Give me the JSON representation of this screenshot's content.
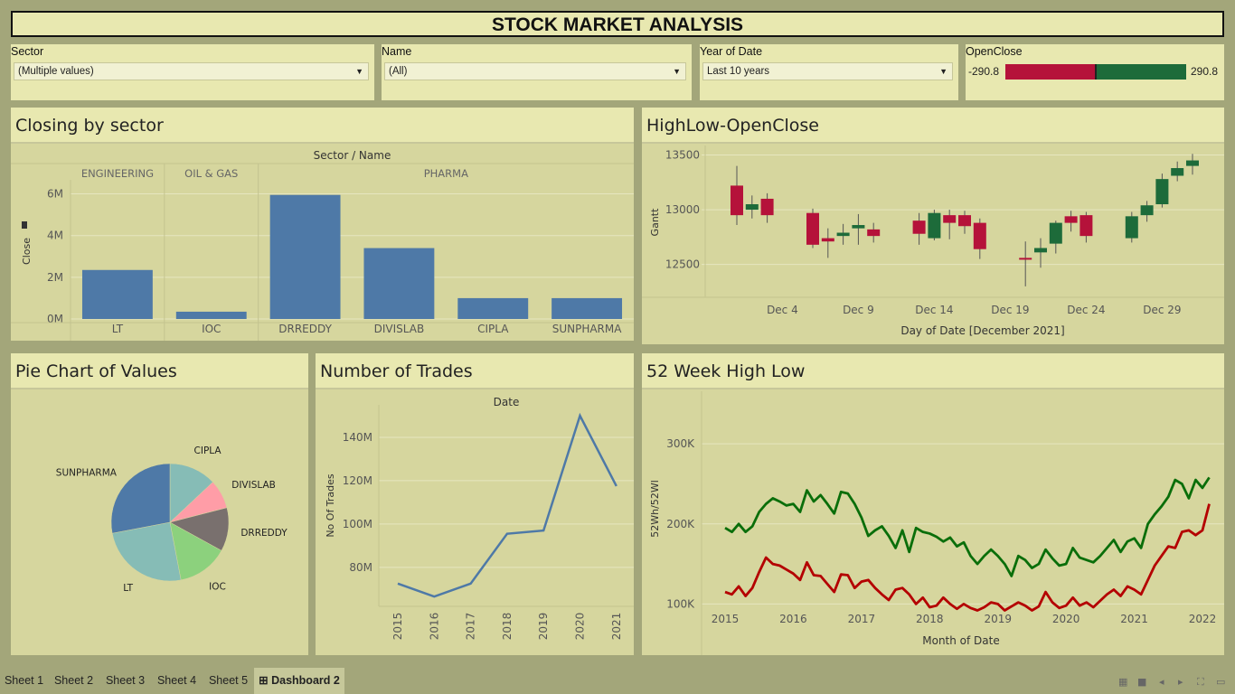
{
  "title": "STOCK MARKET ANALYSIS",
  "filters": {
    "sector": {
      "label": "Sector",
      "value": "(Multiple values)"
    },
    "name": {
      "label": "Name",
      "value": "(All)"
    },
    "year": {
      "label": "Year of Date",
      "value": "Last 10 years"
    },
    "openclose": {
      "label": "OpenClose",
      "min": "-290.8",
      "max": "290.8",
      "neg_color": "#b5123a",
      "pos_color": "#1d6b3a"
    }
  },
  "panels": {
    "closing": "Closing by sector",
    "hilo": "HighLow-OpenClose",
    "pie": "Pie Chart of Values",
    "trades": "Number of Trades",
    "wk52": "52 Week High Low"
  },
  "colors": {
    "bar": "#4e79a7",
    "up": "#1d6b3a",
    "down": "#b5123a",
    "line": "#4e79a7",
    "high": "#0a6e0a",
    "low": "#b40000"
  },
  "chart_data": [
    {
      "id": "closing",
      "type": "bar",
      "title": "Closing by sector",
      "header": "Sector / Name",
      "ylabel": "Close",
      "ylim": [
        0,
        6500000
      ],
      "yticks": [
        {
          "v": 0,
          "label": "0M"
        },
        {
          "v": 2000000,
          "label": "2M"
        },
        {
          "v": 4000000,
          "label": "4M"
        },
        {
          "v": 6000000,
          "label": "6M"
        }
      ],
      "groups": [
        {
          "name": "ENGINEERING",
          "items": [
            {
              "name": "LT",
              "value": 2350000
            }
          ]
        },
        {
          "name": "OIL & GAS",
          "items": [
            {
              "name": "IOC",
              "value": 350000
            }
          ]
        },
        {
          "name": "PHARMA",
          "items": [
            {
              "name": "DRREDDY",
              "value": 5950000
            },
            {
              "name": "DIVISLAB",
              "value": 3400000
            },
            {
              "name": "CIPLA",
              "value": 1000000
            },
            {
              "name": "SUNPHARMA",
              "value": 1000000
            }
          ]
        }
      ]
    },
    {
      "id": "hilo",
      "type": "candlestick",
      "title": "HighLow-OpenClose",
      "xlabel": "Day of Date [December 2021]",
      "ylabel": "Gantt",
      "ylim": [
        12200,
        13570
      ],
      "yticks": [
        12500,
        13000,
        13500
      ],
      "xticks": [
        {
          "day": 4,
          "label": "Dec 4"
        },
        {
          "day": 9,
          "label": "Dec 9"
        },
        {
          "day": 14,
          "label": "Dec 14"
        },
        {
          "day": 19,
          "label": "Dec 19"
        },
        {
          "day": 24,
          "label": "Dec 24"
        },
        {
          "day": 29,
          "label": "Dec 29"
        }
      ],
      "candles": [
        {
          "day": 1,
          "open": 13220,
          "close": 12950,
          "high": 13400,
          "low": 12860
        },
        {
          "day": 2,
          "open": 13000,
          "close": 13050,
          "high": 13130,
          "low": 12920
        },
        {
          "day": 3,
          "open": 13100,
          "close": 12950,
          "high": 13150,
          "low": 12880
        },
        {
          "day": 6,
          "open": 12970,
          "close": 12680,
          "high": 13010,
          "low": 12650
        },
        {
          "day": 7,
          "open": 12740,
          "close": 12710,
          "high": 12830,
          "low": 12560
        },
        {
          "day": 8,
          "open": 12760,
          "close": 12790,
          "high": 12870,
          "low": 12680
        },
        {
          "day": 9,
          "open": 12830,
          "close": 12860,
          "high": 12960,
          "low": 12680
        },
        {
          "day": 10,
          "open": 12820,
          "close": 12760,
          "high": 12880,
          "low": 12700
        },
        {
          "day": 13,
          "open": 12900,
          "close": 12780,
          "high": 12970,
          "low": 12680
        },
        {
          "day": 14,
          "open": 12740,
          "close": 12970,
          "high": 13000,
          "low": 12720
        },
        {
          "day": 15,
          "open": 12950,
          "close": 12880,
          "high": 13000,
          "low": 12730
        },
        {
          "day": 16,
          "open": 12950,
          "close": 12850,
          "high": 12990,
          "low": 12780
        },
        {
          "day": 17,
          "open": 12880,
          "close": 12640,
          "high": 12920,
          "low": 12550
        },
        {
          "day": 20,
          "open": 12560,
          "close": 12550,
          "high": 12710,
          "low": 12300
        },
        {
          "day": 21,
          "open": 12610,
          "close": 12650,
          "high": 12740,
          "low": 12470
        },
        {
          "day": 22,
          "open": 12690,
          "close": 12880,
          "high": 12900,
          "low": 12600
        },
        {
          "day": 23,
          "open": 12940,
          "close": 12880,
          "high": 12990,
          "low": 12800
        },
        {
          "day": 24,
          "open": 12950,
          "close": 12760,
          "high": 12980,
          "low": 12700
        },
        {
          "day": 27,
          "open": 12740,
          "close": 12940,
          "high": 12980,
          "low": 12700
        },
        {
          "day": 28,
          "open": 12950,
          "close": 13040,
          "high": 13080,
          "low": 12890
        },
        {
          "day": 29,
          "open": 13050,
          "close": 13280,
          "high": 13330,
          "low": 13020
        },
        {
          "day": 30,
          "open": 13310,
          "close": 13380,
          "high": 13440,
          "low": 13260
        },
        {
          "day": 31,
          "open": 13400,
          "close": 13450,
          "high": 13510,
          "low": 13320
        }
      ]
    },
    {
      "id": "pie",
      "type": "pie",
      "title": "Pie Chart of Values",
      "slices": [
        {
          "name": "CIPLA",
          "value": 13,
          "color": "#86bcb6"
        },
        {
          "name": "DIVISLAB",
          "value": 8,
          "color": "#ff9da7"
        },
        {
          "name": "DRREDDY",
          "value": 12,
          "color": "#79706e"
        },
        {
          "name": "IOC",
          "value": 14,
          "color": "#8cd17d"
        },
        {
          "name": "LT",
          "value": 25,
          "color": "#86bcb6"
        },
        {
          "name": "SUNPHARMA",
          "value": 28,
          "color": "#4e79a7"
        }
      ]
    },
    {
      "id": "trades",
      "type": "line",
      "title": "Number of Trades",
      "header": "Date",
      "ylabel": "No Of Trades",
      "ylim": [
        62000000,
        155000000
      ],
      "yticks": [
        {
          "v": 80000000,
          "label": "80M"
        },
        {
          "v": 100000000,
          "label": "100M"
        },
        {
          "v": 120000000,
          "label": "120M"
        },
        {
          "v": 140000000,
          "label": "140M"
        }
      ],
      "x": [
        "2015",
        "2016",
        "2017",
        "2018",
        "2019",
        "2020",
        "2021"
      ],
      "values": [
        72500000,
        66500000,
        72500000,
        95500000,
        97000000,
        150000000,
        117500000
      ]
    },
    {
      "id": "wk52",
      "type": "line",
      "title": "52 Week High Low",
      "xlabel": "Month of Date",
      "ylabel": "52Wh/52Wl",
      "ylim": [
        70000,
        360000
      ],
      "yticks": [
        {
          "v": 100000,
          "label": "100K"
        },
        {
          "v": 200000,
          "label": "200K"
        },
        {
          "v": 300000,
          "label": "300K"
        }
      ],
      "xlim": [
        2014.8,
        2022.1
      ],
      "xticks": [
        2015,
        2016,
        2017,
        2018,
        2019,
        2020,
        2021,
        2022
      ],
      "series": [
        {
          "key": "high",
          "points": [
            [
              2015.0,
              195000
            ],
            [
              2015.1,
              190000
            ],
            [
              2015.2,
              200000
            ],
            [
              2015.3,
              190000
            ],
            [
              2015.4,
              197000
            ],
            [
              2015.5,
              215000
            ],
            [
              2015.6,
              225000
            ],
            [
              2015.7,
              232000
            ],
            [
              2015.8,
              228000
            ],
            [
              2015.9,
              223000
            ],
            [
              2016.0,
              225000
            ],
            [
              2016.1,
              215000
            ],
            [
              2016.2,
              242000
            ],
            [
              2016.3,
              228000
            ],
            [
              2016.4,
              236000
            ],
            [
              2016.5,
              225000
            ],
            [
              2016.6,
              213000
            ],
            [
              2016.7,
              240000
            ],
            [
              2016.8,
              238000
            ],
            [
              2016.9,
              225000
            ],
            [
              2017.0,
              208000
            ],
            [
              2017.1,
              185000
            ],
            [
              2017.2,
              192000
            ],
            [
              2017.3,
              197000
            ],
            [
              2017.4,
              185000
            ],
            [
              2017.5,
              170000
            ],
            [
              2017.6,
              192000
            ],
            [
              2017.7,
              165000
            ],
            [
              2017.8,
              195000
            ],
            [
              2017.9,
              190000
            ],
            [
              2018.0,
              188000
            ],
            [
              2018.1,
              184000
            ],
            [
              2018.2,
              178000
            ],
            [
              2018.3,
              183000
            ],
            [
              2018.4,
              172000
            ],
            [
              2018.5,
              177000
            ],
            [
              2018.6,
              160000
            ],
            [
              2018.7,
              150000
            ],
            [
              2018.8,
              160000
            ],
            [
              2018.9,
              168000
            ],
            [
              2019.0,
              160000
            ],
            [
              2019.1,
              150000
            ],
            [
              2019.2,
              135000
            ],
            [
              2019.3,
              160000
            ],
            [
              2019.4,
              155000
            ],
            [
              2019.5,
              145000
            ],
            [
              2019.6,
              150000
            ],
            [
              2019.7,
              168000
            ],
            [
              2019.8,
              157000
            ],
            [
              2019.9,
              148000
            ],
            [
              2020.0,
              150000
            ],
            [
              2020.1,
              170000
            ],
            [
              2020.2,
              158000
            ],
            [
              2020.3,
              155000
            ],
            [
              2020.4,
              152000
            ],
            [
              2020.5,
              160000
            ],
            [
              2020.6,
              170000
            ],
            [
              2020.7,
              180000
            ],
            [
              2020.8,
              165000
            ],
            [
              2020.9,
              178000
            ],
            [
              2021.0,
              182000
            ],
            [
              2021.1,
              170000
            ],
            [
              2021.2,
              200000
            ],
            [
              2021.3,
              212000
            ],
            [
              2021.4,
              222000
            ],
            [
              2021.5,
              234000
            ],
            [
              2021.6,
              255000
            ],
            [
              2021.7,
              250000
            ],
            [
              2021.8,
              232000
            ],
            [
              2021.9,
              255000
            ],
            [
              2022.0,
              245000
            ],
            [
              2022.1,
              258000
            ]
          ]
        },
        {
          "key": "low",
          "points": [
            [
              2015.0,
              115000
            ],
            [
              2015.1,
              112000
            ],
            [
              2015.2,
              122000
            ],
            [
              2015.3,
              110000
            ],
            [
              2015.4,
              120000
            ],
            [
              2015.5,
              140000
            ],
            [
              2015.6,
              158000
            ],
            [
              2015.7,
              150000
            ],
            [
              2015.8,
              148000
            ],
            [
              2015.9,
              143000
            ],
            [
              2016.0,
              138000
            ],
            [
              2016.1,
              130000
            ],
            [
              2016.2,
              152000
            ],
            [
              2016.3,
              136000
            ],
            [
              2016.4,
              135000
            ],
            [
              2016.5,
              125000
            ],
            [
              2016.6,
              115000
            ],
            [
              2016.7,
              137000
            ],
            [
              2016.8,
              136000
            ],
            [
              2016.9,
              120000
            ],
            [
              2017.0,
              128000
            ],
            [
              2017.1,
              130000
            ],
            [
              2017.2,
              120000
            ],
            [
              2017.3,
              112000
            ],
            [
              2017.4,
              105000
            ],
            [
              2017.5,
              118000
            ],
            [
              2017.6,
              120000
            ],
            [
              2017.7,
              112000
            ],
            [
              2017.8,
              100000
            ],
            [
              2017.9,
              108000
            ],
            [
              2018.0,
              96000
            ],
            [
              2018.1,
              98000
            ],
            [
              2018.2,
              108000
            ],
            [
              2018.3,
              100000
            ],
            [
              2018.4,
              94000
            ],
            [
              2018.5,
              100000
            ],
            [
              2018.6,
              95000
            ],
            [
              2018.7,
              92000
            ],
            [
              2018.8,
              96000
            ],
            [
              2018.9,
              102000
            ],
            [
              2019.0,
              100000
            ],
            [
              2019.1,
              92000
            ],
            [
              2019.2,
              97000
            ],
            [
              2019.3,
              102000
            ],
            [
              2019.4,
              98000
            ],
            [
              2019.5,
              92000
            ],
            [
              2019.6,
              97000
            ],
            [
              2019.7,
              115000
            ],
            [
              2019.8,
              102000
            ],
            [
              2019.9,
              95000
            ],
            [
              2020.0,
              98000
            ],
            [
              2020.1,
              108000
            ],
            [
              2020.2,
              98000
            ],
            [
              2020.3,
              102000
            ],
            [
              2020.4,
              96000
            ],
            [
              2020.5,
              104000
            ],
            [
              2020.6,
              112000
            ],
            [
              2020.7,
              118000
            ],
            [
              2020.8,
              110000
            ],
            [
              2020.9,
              122000
            ],
            [
              2021.0,
              118000
            ],
            [
              2021.1,
              112000
            ],
            [
              2021.2,
              130000
            ],
            [
              2021.3,
              148000
            ],
            [
              2021.4,
              160000
            ],
            [
              2021.5,
              172000
            ],
            [
              2021.6,
              170000
            ],
            [
              2021.7,
              190000
            ],
            [
              2021.8,
              192000
            ],
            [
              2021.9,
              186000
            ],
            [
              2022.0,
              192000
            ],
            [
              2022.1,
              225000
            ]
          ]
        }
      ]
    }
  ],
  "tabs": [
    "Sheet 1",
    "Sheet 2",
    "Sheet 3",
    "Sheet 4",
    "Sheet 5",
    "Dashboard 2"
  ],
  "active_tab": "Dashboard 2"
}
